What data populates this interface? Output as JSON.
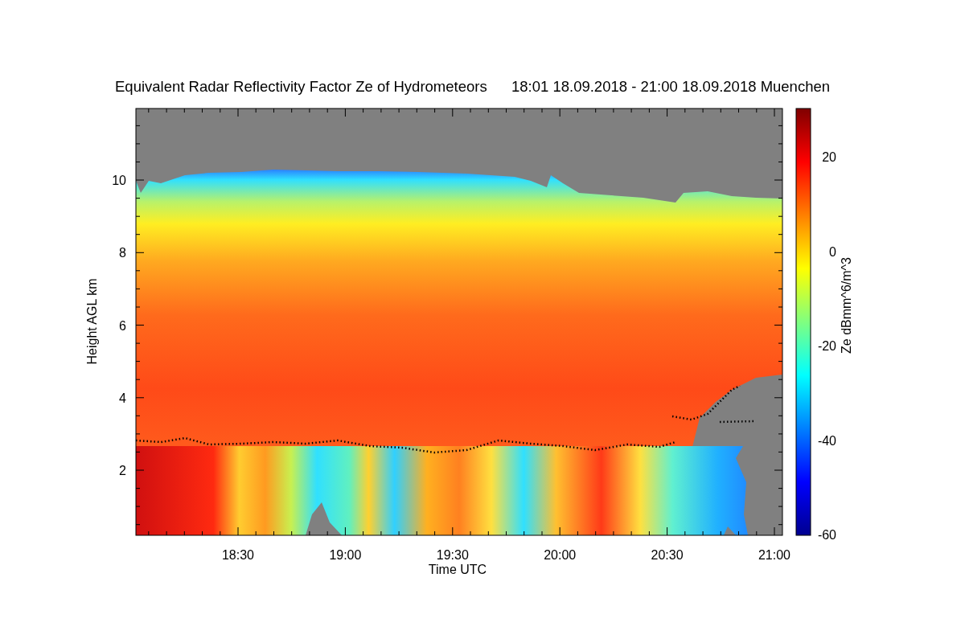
{
  "title": "Equivalent Radar Reflectivity Factor Ze of Hydrometeors",
  "period": "18:01 18.09.2018 - 21:00 18.09.2018 Muenchen",
  "x_axis": {
    "label": "Time UTC",
    "ticks": [
      "18:30",
      "19:00",
      "19:30",
      "20:00",
      "20:30",
      "21:00"
    ]
  },
  "y_axis": {
    "label": "Height AGL km",
    "ticks": [
      "10",
      "8",
      "6",
      "4",
      "2"
    ]
  },
  "colorbar": {
    "label": "Ze dBmm^6/m^3",
    "ticks": [
      "20",
      "0",
      "-20",
      "-40",
      "-60"
    ]
  }
}
